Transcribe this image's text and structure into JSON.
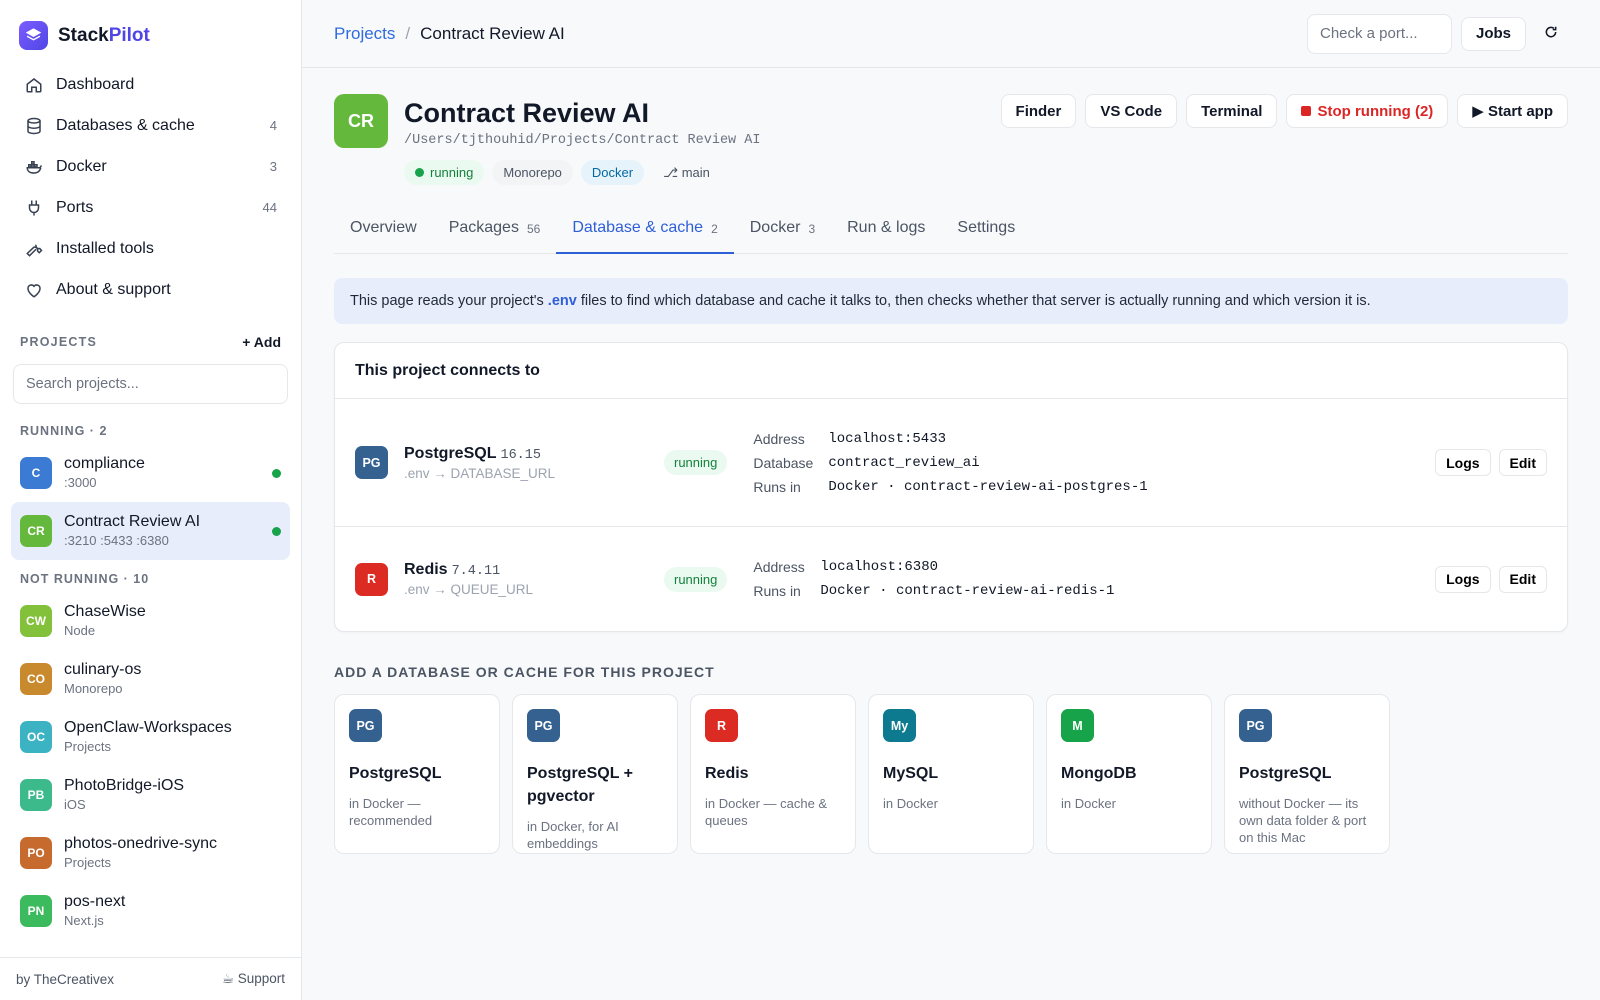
{
  "brand": {
    "name_a": "Stack",
    "name_b": "Pilot"
  },
  "nav": [
    {
      "label": "Dashboard",
      "count": "",
      "icon": "home-icon"
    },
    {
      "label": "Databases & cache",
      "count": "4",
      "icon": "database-icon"
    },
    {
      "label": "Docker",
      "count": "3",
      "icon": "docker-icon"
    },
    {
      "label": "Ports",
      "count": "44",
      "icon": "plug-icon"
    },
    {
      "label": "Installed tools",
      "count": "",
      "icon": "wrench-icon"
    },
    {
      "label": "About & support",
      "count": "",
      "icon": "heart-icon"
    }
  ],
  "projects_section": {
    "title": "PROJECTS",
    "add_label": "+ Add",
    "search_placeholder": "Search projects..."
  },
  "running_group": {
    "label": "RUNNING · 2"
  },
  "running": [
    {
      "initials": "C",
      "name": "compliance",
      "sub": ":3000",
      "color": "#3b7bd4"
    },
    {
      "initials": "CR",
      "name": "Contract Review AI",
      "sub": ":3210 :5433 :6380",
      "color": "#64b93c"
    }
  ],
  "not_running_group": {
    "label": "NOT RUNNING · 10"
  },
  "not_running": [
    {
      "initials": "CW",
      "name": "ChaseWise",
      "sub": "Node",
      "color": "#84c13b"
    },
    {
      "initials": "CO",
      "name": "culinary-os",
      "sub": "Monorepo",
      "color": "#c98a2e"
    },
    {
      "initials": "OC",
      "name": "OpenClaw-Workspaces",
      "sub": "Projects",
      "color": "#3bb3c3"
    },
    {
      "initials": "PB",
      "name": "PhotoBridge-iOS",
      "sub": "iOS",
      "color": "#3cba8c"
    },
    {
      "initials": "PO",
      "name": "photos-onedrive-sync",
      "sub": "Projects",
      "color": "#c76a2e"
    },
    {
      "initials": "PN",
      "name": "pos-next",
      "sub": "Next.js",
      "color": "#3cba5e"
    }
  ],
  "footer": {
    "by": "by TheCreativex",
    "support": "☕ Support"
  },
  "topbar": {
    "crumb_root": "Projects",
    "crumb_sep": "/",
    "crumb_current": "Contract Review AI",
    "port_placeholder": "Check a port...",
    "jobs_label": "Jobs"
  },
  "project": {
    "initials": "CR",
    "title": "Contract Review AI",
    "path": "/Users/tjthouhid/Projects/Contract Review AI",
    "badge_running": "running",
    "badge_type": "Monorepo",
    "badge_docker": "Docker",
    "badge_branch": "⎇ main",
    "actions": {
      "finder": "Finder",
      "vscode": "VS Code",
      "terminal": "Terminal",
      "stop": "Stop running (2)",
      "start": "▶ Start app"
    }
  },
  "tabs": [
    {
      "label": "Overview",
      "count": ""
    },
    {
      "label": "Packages",
      "count": "56"
    },
    {
      "label": "Database & cache",
      "count": "2"
    },
    {
      "label": "Docker",
      "count": "3"
    },
    {
      "label": "Run & logs",
      "count": ""
    },
    {
      "label": "Settings",
      "count": ""
    }
  ],
  "info": {
    "pre": "This page reads your project's",
    "env": ".env",
    "post": "files to find which database and cache it talks to, then checks whether that server is actually running and which version it is."
  },
  "connects": {
    "title": "This project connects to",
    "pg": {
      "initials": "PG",
      "name": "PostgreSQL",
      "version": "16.15",
      "source": ".env → DATABASE_URL",
      "status": "running",
      "address_k": "Address",
      "address_v": "localhost:5433",
      "database_k": "Database",
      "database_v": "contract_review_ai",
      "runs_k": "Runs in",
      "runs_v": "Docker · contract-review-ai-postgres-1",
      "logs": "Logs",
      "edit": "Edit"
    },
    "redis": {
      "initials": "R",
      "name": "Redis",
      "version": "7.4.11",
      "source": ".env → QUEUE_URL",
      "status": "running",
      "address_k": "Address",
      "address_v": "localhost:6380",
      "runs_k": "Runs in",
      "runs_v": "Docker · contract-review-ai-redis-1",
      "logs": "Logs",
      "edit": "Edit"
    }
  },
  "add_section": {
    "title": "ADD A DATABASE OR CACHE FOR THIS PROJECT"
  },
  "tiles": [
    {
      "initials": "PG",
      "name": "PostgreSQL",
      "desc": "in Docker — recommended",
      "color": "#34618f"
    },
    {
      "initials": "PG",
      "name": "PostgreSQL + pgvector",
      "desc": "in Docker, for AI embeddings",
      "color": "#34618f"
    },
    {
      "initials": "R",
      "name": "Redis",
      "desc": "in Docker — cache & queues",
      "color": "#dc2b22"
    },
    {
      "initials": "My",
      "name": "MySQL",
      "desc": "in Docker",
      "color": "#0d7a8f"
    },
    {
      "initials": "M",
      "name": "MongoDB",
      "desc": "in Docker",
      "color": "#16a34a"
    },
    {
      "initials": "PG",
      "name": "PostgreSQL",
      "desc": "without Docker — its own data folder & port on this Mac",
      "color": "#34618f"
    }
  ]
}
